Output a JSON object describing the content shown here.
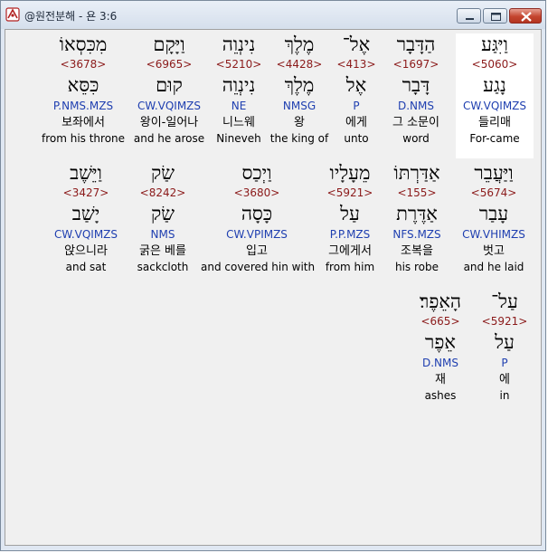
{
  "window": {
    "title": "@원전분해 - 욘 3:6"
  },
  "lines": [
    {
      "words": [
        {
          "hebrew": "וַיִּגַּע",
          "strong": "<5060>",
          "lemma": "נָגַע",
          "morph": "CW.VQIMZS",
          "korean": "들리매",
          "english": "For-came",
          "selected": true
        },
        {
          "hebrew": "הַדָּבָר",
          "strong": "<1697>",
          "lemma": "דָּבָר",
          "morph": "D.NMS",
          "korean": "그 소문이",
          "english": "word"
        },
        {
          "hebrew": "אֶל־",
          "strong": "<413>",
          "lemma": "אֶל",
          "morph": "P",
          "korean": "에게",
          "english": "unto"
        },
        {
          "hebrew": "מֶלֶךְ",
          "strong": "<4428>",
          "lemma": "מֶלֶךְ",
          "morph": "NMSG",
          "korean": "왕",
          "english": "the king of"
        },
        {
          "hebrew": "נִינְוֵה",
          "strong": "<5210>",
          "lemma": "נִינְוֵה",
          "morph": "NE",
          "korean": "니느웨",
          "english": "Nineveh"
        },
        {
          "hebrew": "וַיָּקָם",
          "strong": "<6965>",
          "lemma": "קוּם",
          "morph": "CW.VQIMZS",
          "korean": "왕이-일어나",
          "english": "and he arose"
        },
        {
          "hebrew": "מִכִּסְאוֹ",
          "strong": "<3678>",
          "lemma": "כִּסֵּא",
          "morph": "P.NMS.MZS",
          "korean": "보좌에서",
          "english": "from his throne"
        }
      ]
    },
    {
      "words": [
        {
          "hebrew": "וַיַּעֲבֵר",
          "strong": "<5674>",
          "lemma": "עָבַר",
          "morph": "CW.VHIMZS",
          "korean": "벗고",
          "english": "and he laid"
        },
        {
          "hebrew": "אַדַּרְתּוֹ",
          "strong": "<155>",
          "lemma": "אַדֶּרֶת",
          "morph": "NFS.MZS",
          "korean": "조복을",
          "english": "his robe"
        },
        {
          "hebrew": "מֵעָלָיו",
          "strong": "<5921>",
          "lemma": "עַל",
          "morph": "P.P.MZS",
          "korean": "그에게서",
          "english": "from him"
        },
        {
          "hebrew": "וַיְכַס",
          "strong": "<3680>",
          "lemma": "כָּסָה",
          "morph": "CW.VPIMZS",
          "korean": "입고",
          "english": "and covered hin with"
        },
        {
          "hebrew": "שַׂק",
          "strong": "<8242>",
          "lemma": "שַׂק",
          "morph": "NMS",
          "korean": "굵은 베를",
          "english": "sackcloth"
        },
        {
          "hebrew": "וַיֵּשֶׁב",
          "strong": "<3427>",
          "lemma": "יָשַׁב",
          "morph": "CW.VQIMZS",
          "korean": "앉으니라",
          "english": "and sat"
        }
      ]
    },
    {
      "words": [
        {
          "hebrew": "עַל־",
          "strong": "<5921>",
          "lemma": "עַל",
          "morph": "P",
          "korean": "에",
          "english": "in"
        },
        {
          "hebrew": "הָאֵפֶר׃",
          "strong": "<665>",
          "lemma": "אֵפֶר",
          "morph": "D.NMS",
          "korean": "재",
          "english": "ashes"
        }
      ]
    }
  ]
}
